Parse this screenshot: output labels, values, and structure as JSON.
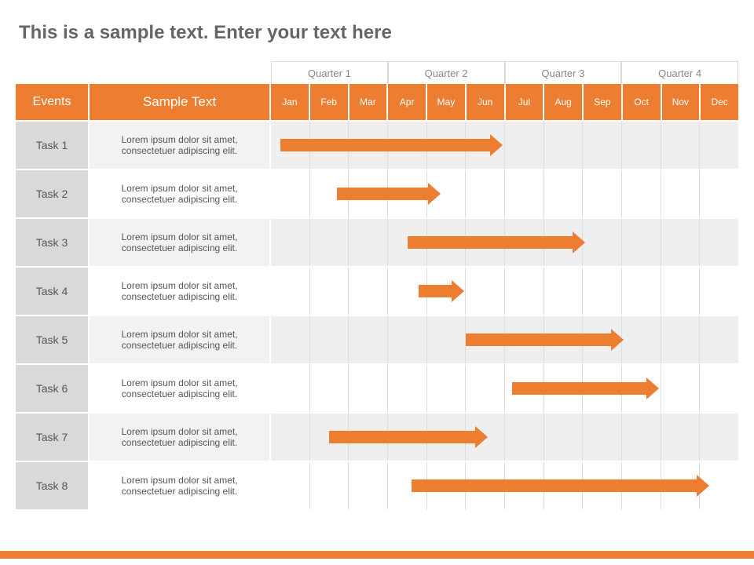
{
  "title": "This is a sample text. Enter your text here",
  "headers": {
    "events": "Events",
    "sample_text": "Sample Text",
    "quarters": [
      "Quarter 1",
      "Quarter 2",
      "Quarter 3",
      "Quarter 4"
    ],
    "months": [
      "Jan",
      "Feb",
      "Mar",
      "Apr",
      "May",
      "Jun",
      "Jul",
      "Aug",
      "Sep",
      "Oct",
      "Nov",
      "Dec"
    ]
  },
  "tasks": [
    {
      "name": "Task 1",
      "desc": "Lorem ipsum dolor sit amet, consectetuer adipiscing elit."
    },
    {
      "name": "Task 2",
      "desc": "Lorem ipsum dolor sit amet, consectetuer adipiscing elit."
    },
    {
      "name": "Task 3",
      "desc": "Lorem ipsum dolor sit amet, consectetuer adipiscing elit."
    },
    {
      "name": "Task 4",
      "desc": "Lorem ipsum dolor sit amet, consectetuer adipiscing elit."
    },
    {
      "name": "Task 5",
      "desc": "Lorem ipsum dolor sit amet, consectetuer adipiscing elit."
    },
    {
      "name": "Task 6",
      "desc": "Lorem ipsum dolor sit amet, consectetuer adipiscing elit."
    },
    {
      "name": "Task 7",
      "desc": "Lorem ipsum dolor sit amet, consectetuer adipiscing elit."
    },
    {
      "name": "Task 8",
      "desc": "Lorem ipsum dolor sit amet, consectetuer adipiscing elit."
    }
  ],
  "chart_data": {
    "type": "gantt",
    "time_axis": {
      "unit": "month",
      "categories": [
        "Jan",
        "Feb",
        "Mar",
        "Apr",
        "May",
        "Jun",
        "Jul",
        "Aug",
        "Sep",
        "Oct",
        "Nov",
        "Dec"
      ],
      "groups": [
        {
          "label": "Quarter 1",
          "start": 1,
          "end": 3
        },
        {
          "label": "Quarter 2",
          "start": 4,
          "end": 6
        },
        {
          "label": "Quarter 3",
          "start": 7,
          "end": 9
        },
        {
          "label": "Quarter 4",
          "start": 10,
          "end": 12
        }
      ]
    },
    "bars": [
      {
        "task": "Task 1",
        "start": 1.25,
        "end": 7.0
      },
      {
        "task": "Task 2",
        "start": 2.7,
        "end": 5.4
      },
      {
        "task": "Task 3",
        "start": 4.5,
        "end": 9.1
      },
      {
        "task": "Task 4",
        "start": 4.8,
        "end": 6.0
      },
      {
        "task": "Task 5",
        "start": 6.0,
        "end": 10.1
      },
      {
        "task": "Task 6",
        "start": 7.2,
        "end": 11.0
      },
      {
        "task": "Task 7",
        "start": 2.5,
        "end": 6.6
      },
      {
        "task": "Task 8",
        "start": 4.6,
        "end": 12.3
      }
    ],
    "color": "#ed7d31"
  }
}
